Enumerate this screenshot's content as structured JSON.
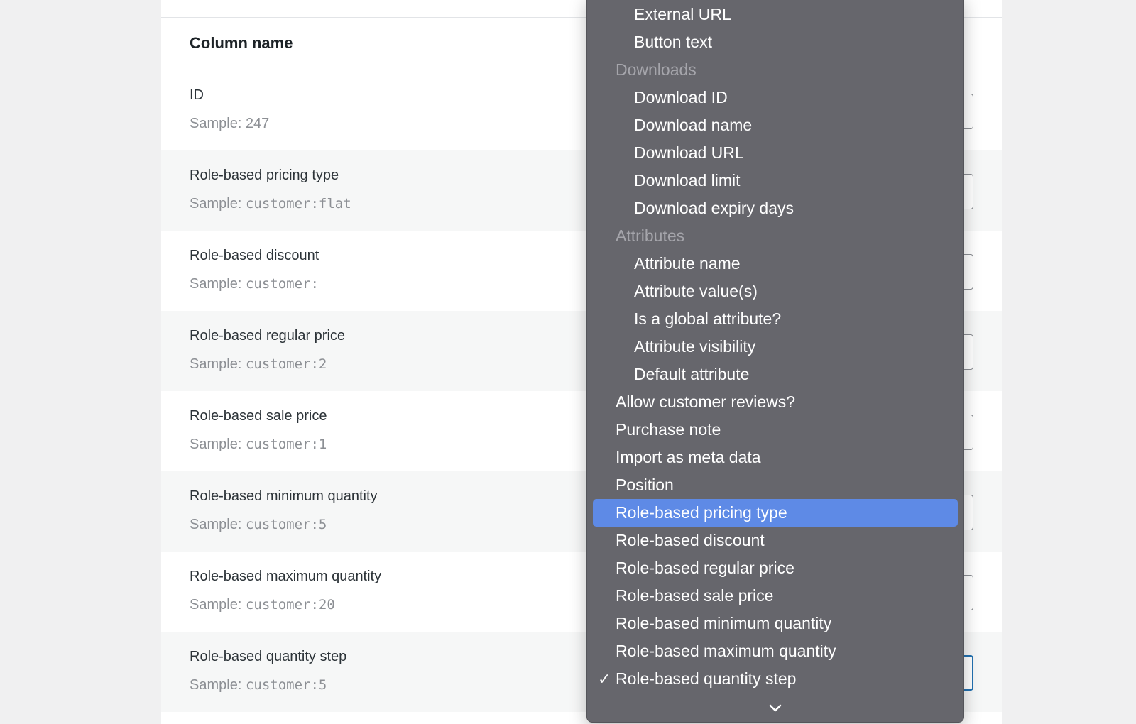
{
  "table": {
    "column_header": "Column name",
    "rows": [
      {
        "label": "ID",
        "sample_prefix": "Sample: ",
        "sample_value": "247",
        "mono": false
      },
      {
        "label": "Role-based pricing type",
        "sample_prefix": "Sample: ",
        "sample_value": "customer:flat",
        "mono": true
      },
      {
        "label": "Role-based discount",
        "sample_prefix": "Sample: ",
        "sample_value": "customer:",
        "mono": true
      },
      {
        "label": "Role-based regular price",
        "sample_prefix": "Sample: ",
        "sample_value": "customer:2",
        "mono": true
      },
      {
        "label": "Role-based sale price",
        "sample_prefix": "Sample: ",
        "sample_value": "customer:1",
        "mono": true
      },
      {
        "label": "Role-based minimum quantity",
        "sample_prefix": "Sample: ",
        "sample_value": "customer:5",
        "mono": true
      },
      {
        "label": "Role-based maximum quantity",
        "sample_prefix": "Sample: ",
        "sample_value": "customer:20",
        "mono": true
      },
      {
        "label": "Role-based quantity step",
        "sample_prefix": "Sample: ",
        "sample_value": "customer:5",
        "mono": true
      }
    ]
  },
  "dropdown": {
    "items": [
      {
        "label": "External URL",
        "kind": "sub"
      },
      {
        "label": "Button text",
        "kind": "sub"
      },
      {
        "label": "Downloads",
        "kind": "group"
      },
      {
        "label": "Download ID",
        "kind": "sub"
      },
      {
        "label": "Download name",
        "kind": "sub"
      },
      {
        "label": "Download URL",
        "kind": "sub"
      },
      {
        "label": "Download limit",
        "kind": "sub"
      },
      {
        "label": "Download expiry days",
        "kind": "sub"
      },
      {
        "label": "Attributes",
        "kind": "group"
      },
      {
        "label": "Attribute name",
        "kind": "sub"
      },
      {
        "label": "Attribute value(s)",
        "kind": "sub"
      },
      {
        "label": "Is a global attribute?",
        "kind": "sub"
      },
      {
        "label": "Attribute visibility",
        "kind": "sub"
      },
      {
        "label": "Default attribute",
        "kind": "sub"
      },
      {
        "label": "Allow customer reviews?",
        "kind": "top"
      },
      {
        "label": "Purchase note",
        "kind": "top"
      },
      {
        "label": "Import as meta data",
        "kind": "top"
      },
      {
        "label": "Position",
        "kind": "top"
      },
      {
        "label": "Role-based pricing type",
        "kind": "top",
        "highlighted": true
      },
      {
        "label": "Role-based discount",
        "kind": "top"
      },
      {
        "label": "Role-based regular price",
        "kind": "top"
      },
      {
        "label": "Role-based sale price",
        "kind": "top"
      },
      {
        "label": "Role-based minimum quantity",
        "kind": "top"
      },
      {
        "label": "Role-based maximum quantity",
        "kind": "top"
      },
      {
        "label": "Role-based quantity step",
        "kind": "top",
        "selected": true
      }
    ],
    "check_glyph": "✓",
    "scroll_icon": "chevron-down-icon"
  },
  "colors": {
    "dropdown_bg": "#66666c",
    "highlight": "#5e8ae6",
    "group_text": "#a5a5ab",
    "focus_border": "#2271b1"
  }
}
